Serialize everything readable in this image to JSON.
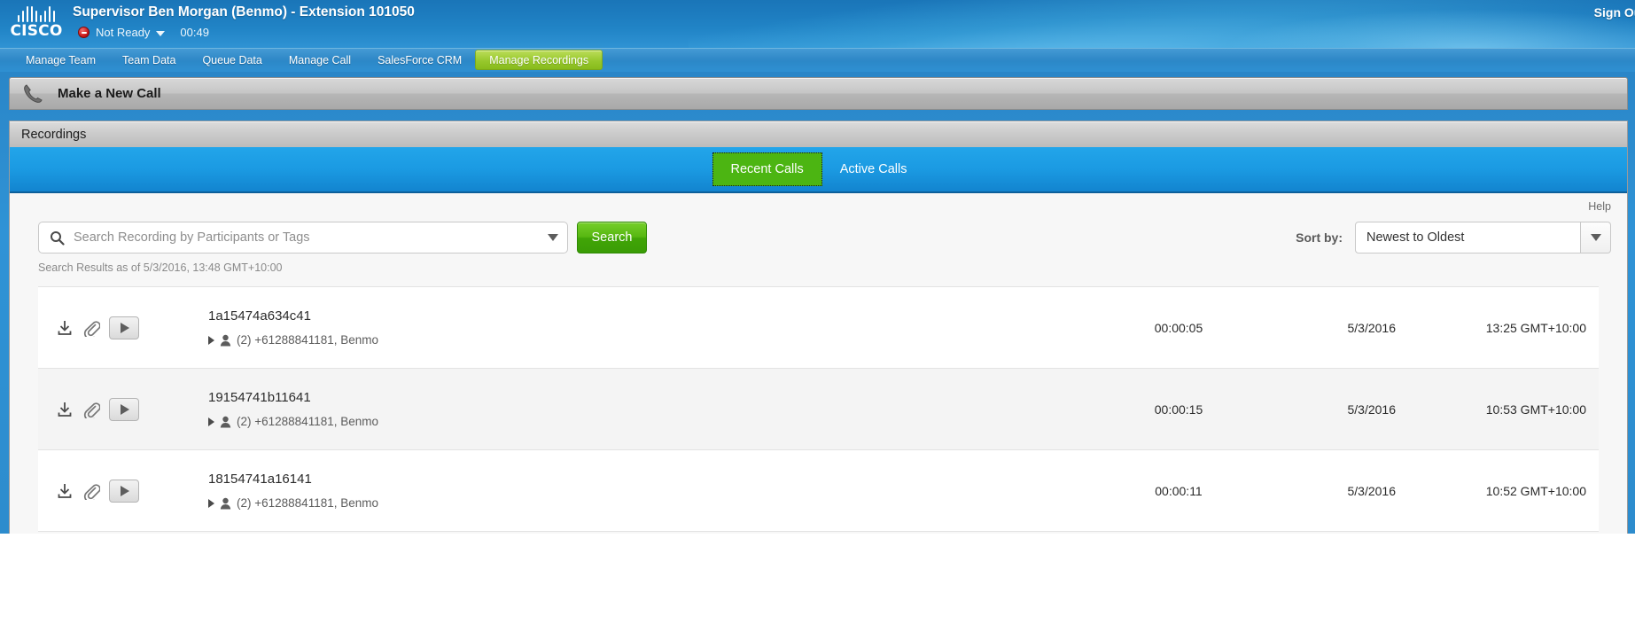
{
  "header": {
    "agent_title": "Supervisor Ben Morgan (Benmo) - Extension 101050",
    "status_text": "Not Ready",
    "status_timer": "00:49",
    "sign_out": "Sign Out",
    "logo_word": "CISCO"
  },
  "nav": {
    "tabs": [
      {
        "label": "Manage Team",
        "active": false
      },
      {
        "label": "Team Data",
        "active": false
      },
      {
        "label": "Queue Data",
        "active": false
      },
      {
        "label": "Manage Call",
        "active": false
      },
      {
        "label": "SalesForce CRM",
        "active": false
      },
      {
        "label": "Manage Recordings",
        "active": true
      }
    ]
  },
  "new_call": {
    "label": "Make a New Call"
  },
  "panel": {
    "title": "Recordings"
  },
  "call_tabs": [
    {
      "label": "Recent Calls",
      "selected": true
    },
    {
      "label": "Active Calls",
      "selected": false
    }
  ],
  "help": {
    "label": "Help"
  },
  "search": {
    "placeholder": "Search Recording by Participants or Tags",
    "value": "",
    "button_label": "Search"
  },
  "sort": {
    "label": "Sort by:",
    "selected": "Newest to Oldest",
    "options": [
      "Newest to Oldest"
    ]
  },
  "results_as_of": "Search Results as of 5/3/2016, 13:48 GMT+10:00",
  "recordings": [
    {
      "id": "1a15474a634c41",
      "participants": "(2) +61288841181, Benmo",
      "duration": "00:00:05",
      "date": "5/3/2016",
      "time": "13:25 GMT+10:00"
    },
    {
      "id": "19154741b11641",
      "participants": "(2) +61288841181, Benmo",
      "duration": "00:00:15",
      "date": "5/3/2016",
      "time": "10:53 GMT+10:00"
    },
    {
      "id": "18154741a16141",
      "participants": "(2) +61288841181, Benmo",
      "duration": "00:00:11",
      "date": "5/3/2016",
      "time": "10:52 GMT+10:00"
    }
  ],
  "colors": {
    "header_blue": "#2184c6",
    "tab_active_green": "#9ccb30",
    "button_green": "#4cb512",
    "tabbar_blue": "#1b9ae2"
  }
}
